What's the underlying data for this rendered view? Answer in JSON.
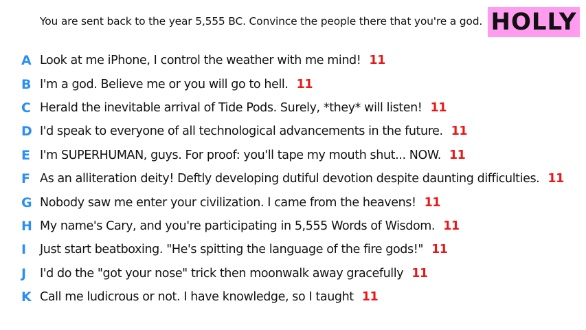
{
  "prompt": "You are sent back to the year 5,555 BC. Convince the people there that you're a god.",
  "player": {
    "name": "HOLLY"
  },
  "colors": {
    "badge_bg": "#ff9cf0",
    "letter": "#2a8ff0",
    "score": "#e81818"
  },
  "responses": [
    {
      "letter": "A",
      "text": "Look at me iPhone, I control the weather with me mind!",
      "score": "11"
    },
    {
      "letter": "B",
      "text": "I'm a god. Believe me or you will go to hell.",
      "score": "11"
    },
    {
      "letter": "C",
      "text": "Herald the inevitable arrival of Tide Pods. Surely, *they* will listen!",
      "score": "11"
    },
    {
      "letter": "D",
      "text": "I'd speak to everyone of all technological advancements in the future.",
      "score": "11"
    },
    {
      "letter": "E",
      "text": "I'm SUPERHUMAN, guys. For proof: you'll tape my mouth shut... NOW.",
      "score": "11"
    },
    {
      "letter": "F",
      "text": "As an alliteration deity! Deftly developing dutiful devotion despite daunting difficulties.",
      "score": "11"
    },
    {
      "letter": "G",
      "text": "Nobody saw me enter your civilization. I came from the heavens!",
      "score": "11"
    },
    {
      "letter": "H",
      "text": "My name's Cary, and you're participating in 5,555 Words of Wisdom.",
      "score": "11"
    },
    {
      "letter": "I",
      "text": "Just start beatboxing. \"He's spitting the language of the fire gods!\"",
      "score": "11"
    },
    {
      "letter": "J",
      "text": "I'd do the \"got your nose\" trick then moonwalk away gracefully",
      "score": "11"
    },
    {
      "letter": "K",
      "text": "Call me ludicrous or not. I have knowledge, so I taught",
      "score": "11"
    }
  ]
}
